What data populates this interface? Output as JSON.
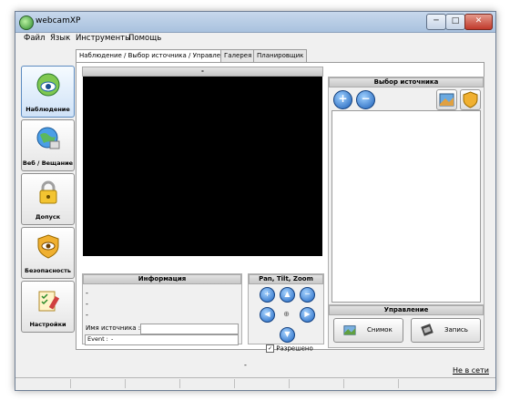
{
  "window": {
    "title": "webcamXP",
    "min_label": "─",
    "max_label": "□",
    "close_label": "✕"
  },
  "menu": [
    "Файл",
    "Язык",
    "Инструменты",
    "Помощь"
  ],
  "nav": [
    {
      "label": "Наблюдение",
      "icon": "eye-icon"
    },
    {
      "label": "Веб / Вещание",
      "icon": "globe-broadcast-icon"
    },
    {
      "label": "Допуск",
      "icon": "padlock-icon"
    },
    {
      "label": "Безопасность",
      "icon": "shield-eye-icon"
    },
    {
      "label": "Настройки",
      "icon": "settings-checklist-icon"
    }
  ],
  "tabs": [
    "Наблюдение / Выбор источника / Управление",
    "Галерея",
    "Планировщик"
  ],
  "video": {
    "header": "-"
  },
  "info": {
    "header": "Информация",
    "lines": [
      "-",
      "-",
      "-"
    ],
    "source_name_label": "Имя источника :",
    "event_label": "Event :",
    "event_value": "-"
  },
  "ptz": {
    "header": "Pan, Tilt, Zoom",
    "center": "⊕",
    "allowed_label": "Разрешено",
    "allowed_checked": true
  },
  "source": {
    "header": "Выбор источника",
    "add_icon": "plus-icon",
    "remove_icon": "minus-icon"
  },
  "control": {
    "header": "Управление",
    "snapshot_label": "Снимок",
    "record_label": "Запись"
  },
  "footer": {
    "center": "-",
    "online_link": "Не в сети"
  },
  "colors": {
    "accent": "#1f66c2",
    "video_bg": "#000000"
  }
}
